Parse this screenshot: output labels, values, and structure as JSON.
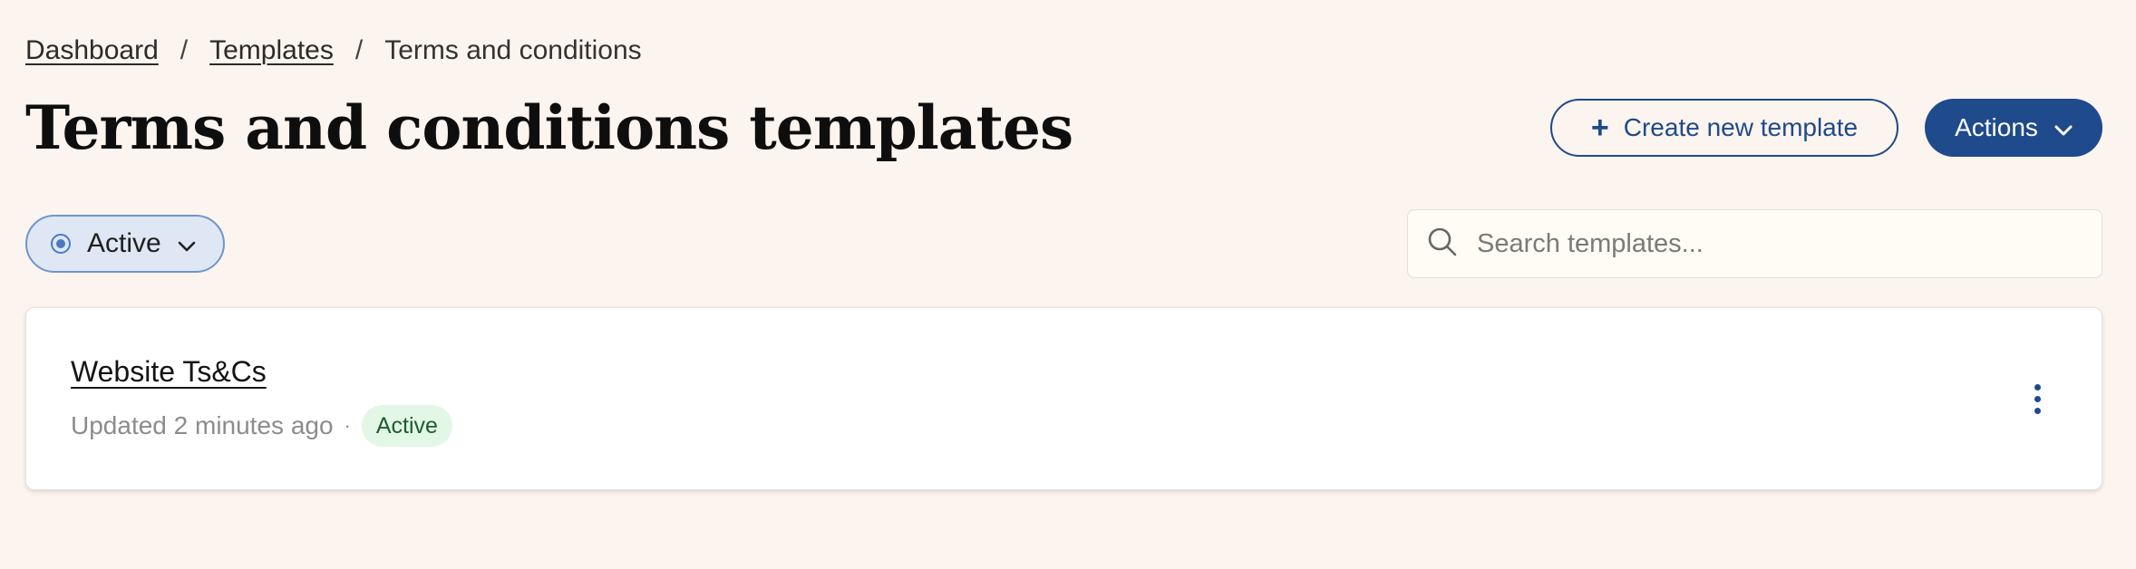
{
  "breadcrumb": {
    "items": [
      "Dashboard",
      "Templates"
    ],
    "separator": "/",
    "current": "Terms and conditions"
  },
  "page_title": "Terms and conditions templates",
  "header_actions": {
    "create_label": "Create new template",
    "create_icon": "plus-icon",
    "actions_label": "Actions",
    "actions_icon": "chevron-down-icon"
  },
  "filter": {
    "selected": "Active",
    "icon": "radio-selected-icon"
  },
  "search": {
    "placeholder": "Search templates...",
    "value": ""
  },
  "templates": [
    {
      "name": "Website Ts&Cs",
      "updated": "Updated 2 minutes ago",
      "separator": "·",
      "status": "Active"
    }
  ],
  "colors": {
    "page_background": "#fcf4ee",
    "primary": "#1f4a8c",
    "filter_background": "#dee7f3",
    "badge_background": "#e3f7e6",
    "badge_text": "#1f5c2c"
  }
}
